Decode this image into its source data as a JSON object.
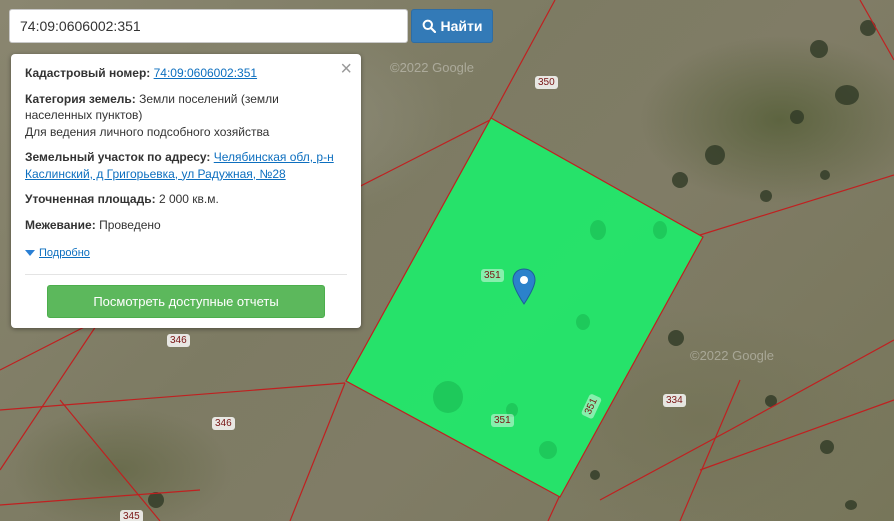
{
  "search": {
    "value": "74:09:0606002:351",
    "button_label": "Найти"
  },
  "popup": {
    "cadastral_label": "Кадастровый номер:",
    "cadastral_value": "74:09:0606002:351",
    "category_label": "Категория земель:",
    "category_value": "Земли поселений (земли населенных пунктов)",
    "category_use": "Для ведения личного подсобного хозяйства",
    "address_label": "Земельный участок по адресу:",
    "address_value": "Челябинская обл, р-н Каслинский, д Григорьевка, ул Радужная, №28",
    "area_label": "Уточненная площадь:",
    "area_value": "2 000 кв.м.",
    "survey_label": "Межевание:",
    "survey_value": "Проведено",
    "more_label": "Подробно",
    "reports_button": "Посмотреть доступные отчеты"
  },
  "map": {
    "parcel_labels": [
      "350",
      "351",
      "351",
      "351",
      "346",
      "346",
      "334",
      "345"
    ],
    "watermarks": [
      "©2022 Google",
      "©2022 Google"
    ],
    "parcel_color": "#22e86a",
    "boundary_color": "#c02020"
  }
}
